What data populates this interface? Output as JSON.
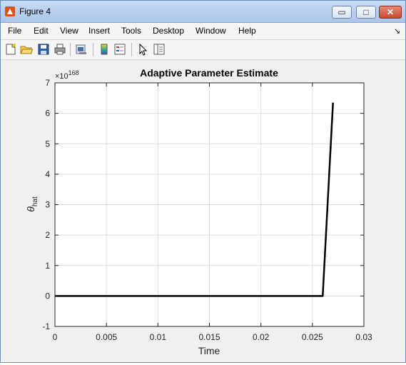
{
  "window": {
    "title": "Figure 4",
    "controls": {
      "minimize": "▭",
      "maximize": "□",
      "close": "✕"
    }
  },
  "menu": [
    "File",
    "Edit",
    "View",
    "Insert",
    "Tools",
    "Desktop",
    "Window",
    "Help"
  ],
  "menu_overflow": "↘",
  "toolbar": [
    "new-figure-icon",
    "open-file-icon",
    "save-icon",
    "print-icon",
    "print-preview-icon",
    "colorbar-icon",
    "legend-icon",
    "pointer-icon",
    "property-editor-icon"
  ],
  "axes": {
    "exponent_prefix": "×10",
    "exponent": "168"
  },
  "chart_data": {
    "type": "line",
    "title": "Adaptive Parameter Estimate",
    "xlabel": "Time",
    "ylabel": "θ",
    "ylabel_sub": "hat",
    "xlim": [
      0,
      0.03
    ],
    "ylim": [
      -1,
      7
    ],
    "xticks": [
      "0",
      "0.005",
      "0.01",
      "0.015",
      "0.02",
      "0.025",
      "0.03"
    ],
    "yticks": [
      "-1",
      "0",
      "1",
      "2",
      "3",
      "4",
      "5",
      "6",
      "7"
    ],
    "grid": true,
    "y_scale_factor": "1e168",
    "series": [
      {
        "color": "#000000",
        "x": [
          0,
          0.026,
          0.027
        ],
        "y": [
          0,
          0,
          6.35
        ]
      }
    ]
  }
}
